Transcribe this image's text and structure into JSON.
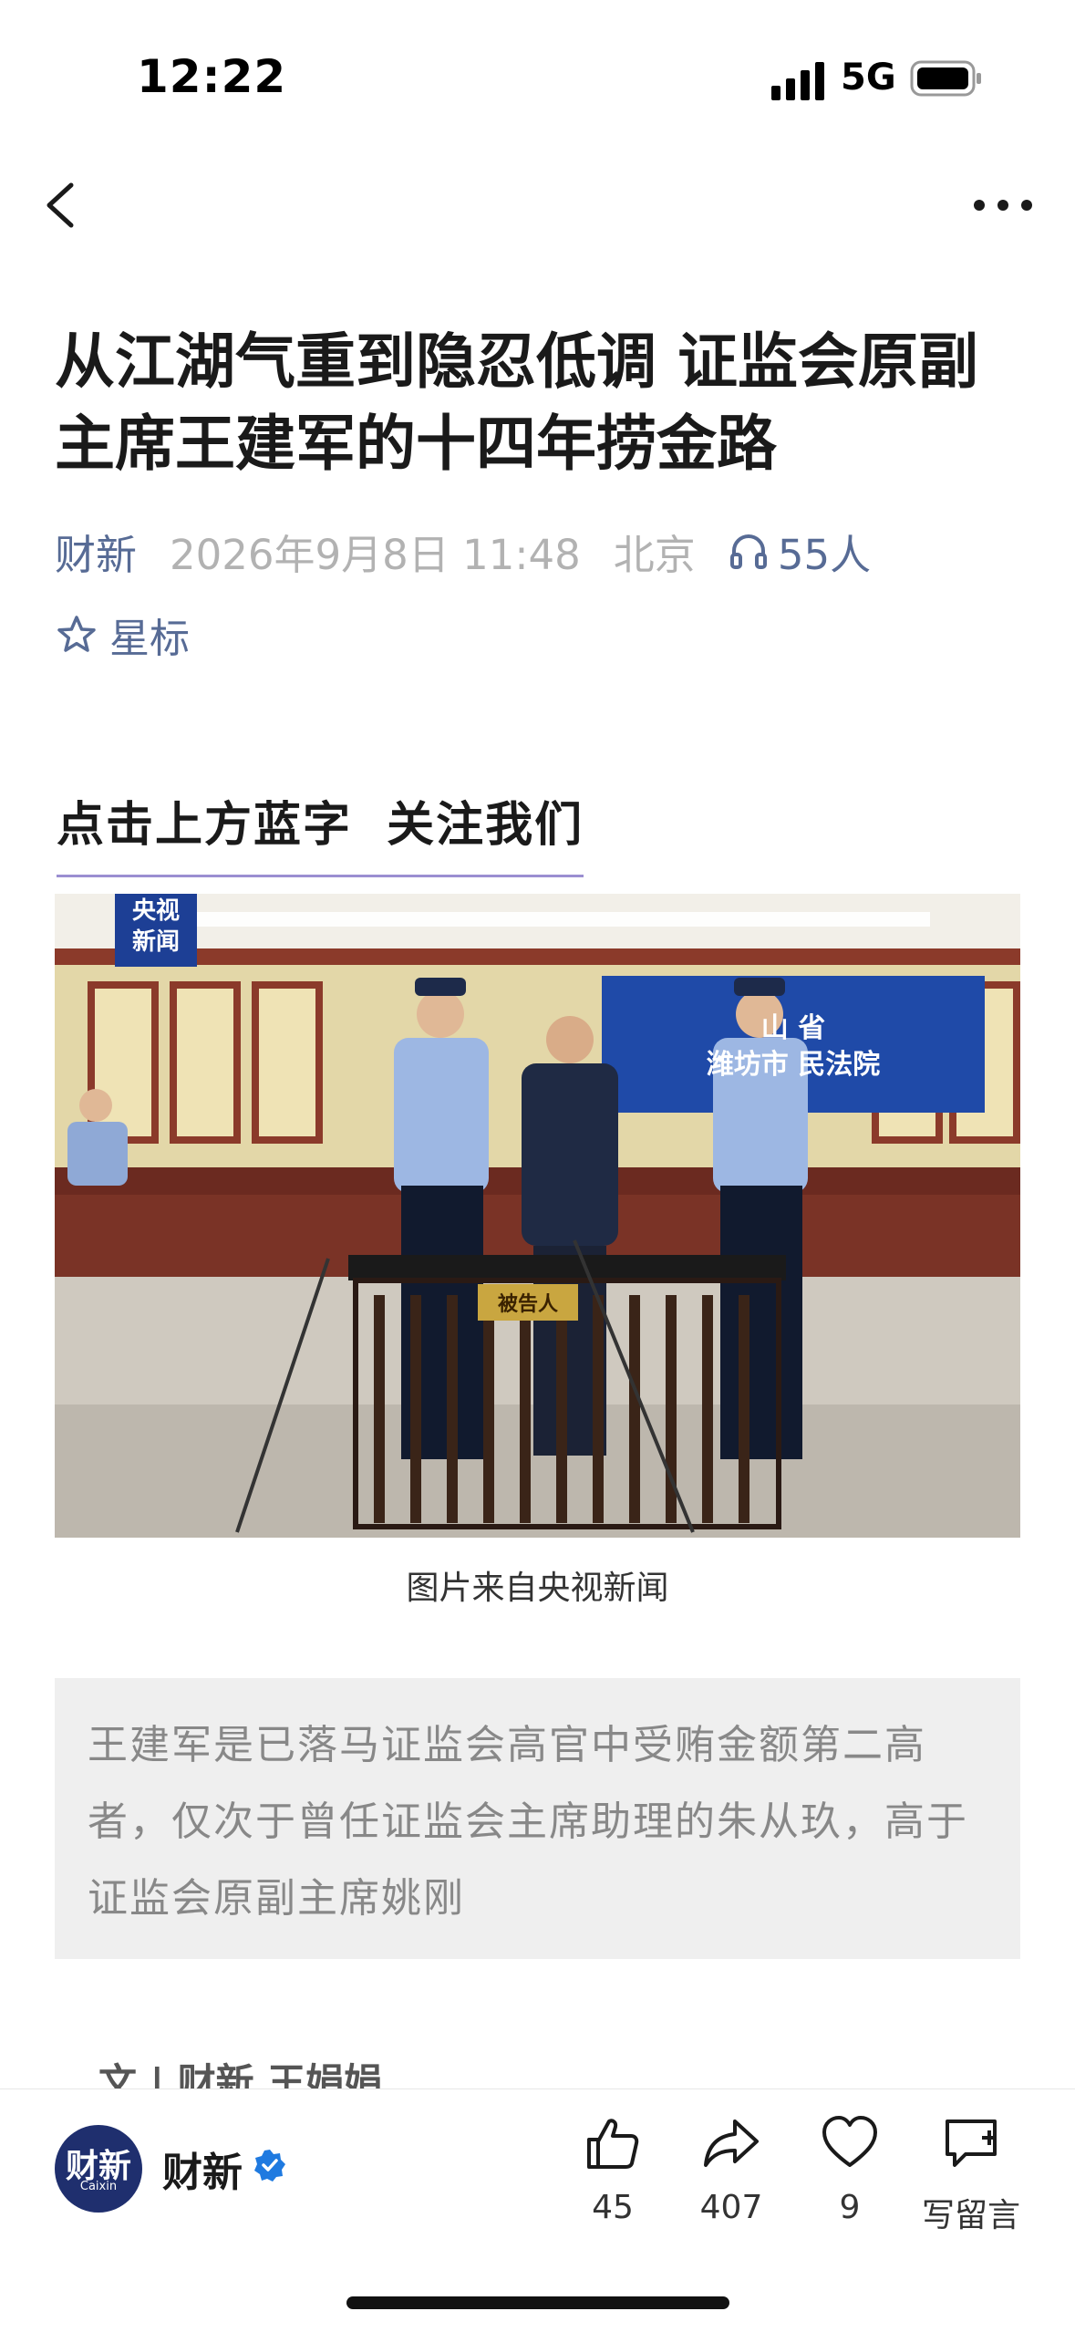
{
  "status_bar": {
    "time": "12:22",
    "network": "5G"
  },
  "article": {
    "title": "从江湖气重到隐忍低调 证监会原副主席王建军的十四年捞金路",
    "source": "财新",
    "date": "2026年9月8日 11:48",
    "city": "北京",
    "listeners": "55人",
    "star_label": "星标",
    "follow_prompt": "点击上方蓝字 关注我们",
    "image_caption": "图片来自央视新闻",
    "image_texts": {
      "logo_top": "央视",
      "logo_bottom": "新闻",
      "court_line1": "山 省",
      "court_line2": "潍坊市 民法院",
      "defendant_sign": "被告人"
    },
    "summary": "王建军是已落马证监会高官中受贿金额第二高者，仅次于曾任证监会主席助理的朱从玖，高于证监会原副主席姚刚",
    "byline": "文 | 财新 王娟娟"
  },
  "bottom_bar": {
    "account_name": "财新",
    "avatar_text": "财新",
    "avatar_sub": "Caixin",
    "like_count": "45",
    "share_count": "407",
    "favorite_count": "9",
    "comment_label": "写留言"
  },
  "colors": {
    "link_blue": "#576b95",
    "avatar_bg": "#1f2f6e",
    "verified": "#1f7ae0"
  }
}
